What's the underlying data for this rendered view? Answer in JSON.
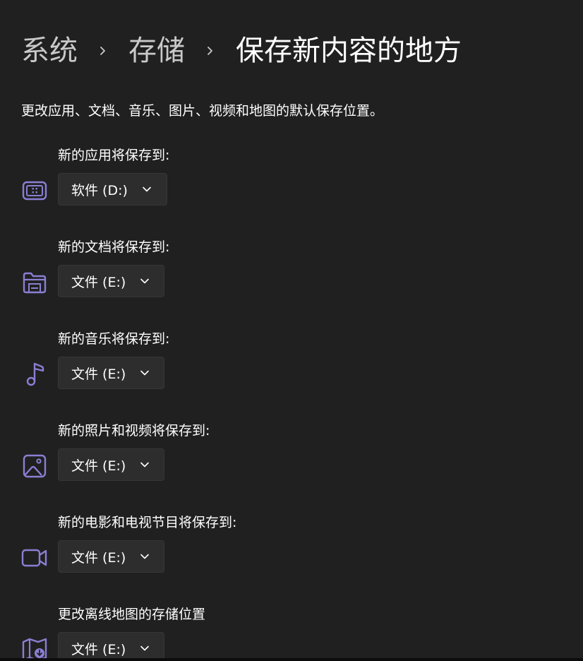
{
  "breadcrumb": {
    "items": [
      "系统",
      "存储",
      "保存新内容的地方"
    ],
    "separator_icon": "chevron-right-icon"
  },
  "description": "更改应用、文档、音乐、图片、视频和地图的默认保存位置。",
  "settings": [
    {
      "label": "新的应用将保存到:",
      "value": "软件 (D:)",
      "icon": "app-icon"
    },
    {
      "label": "新的文档将保存到:",
      "value": "文件 (E:)",
      "icon": "document-folder-icon"
    },
    {
      "label": "新的音乐将保存到:",
      "value": "文件 (E:)",
      "icon": "music-note-icon"
    },
    {
      "label": "新的照片和视频将保存到:",
      "value": "文件 (E:)",
      "icon": "picture-icon"
    },
    {
      "label": "新的电影和电视节目将保存到:",
      "value": "文件 (E:)",
      "icon": "video-camera-icon"
    },
    {
      "label": "更改离线地图的存储位置",
      "value": "文件 (E:)",
      "icon": "offline-map-icon"
    }
  ],
  "colors": {
    "background": "#202020",
    "dropdown_bg": "#2d2d2d",
    "icon_accent": "#8a7fd3",
    "breadcrumb_parent": "#c9c9c9",
    "text": "#ffffff"
  }
}
